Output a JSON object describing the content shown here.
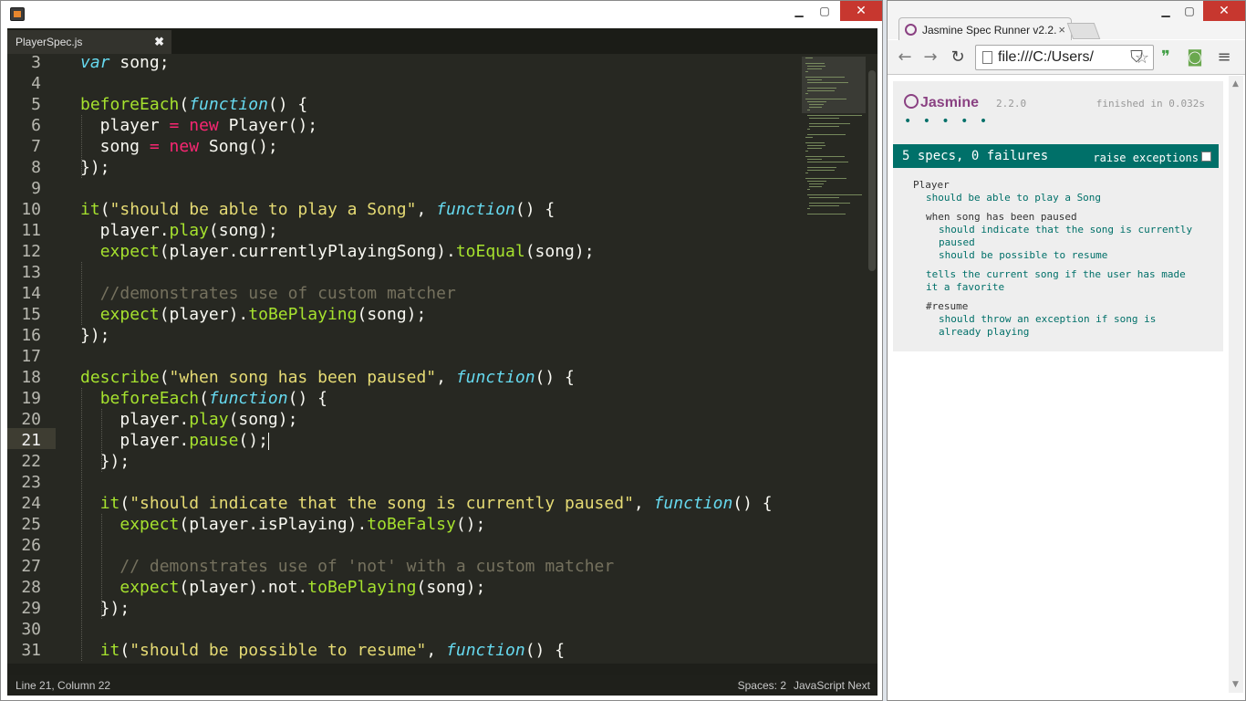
{
  "sublime": {
    "tab_label": "PlayerSpec.js",
    "tab_close": "✖",
    "line_numbers": [
      "3",
      "4",
      "5",
      "6",
      "7",
      "8",
      "9",
      "10",
      "11",
      "12",
      "13",
      "14",
      "15",
      "16",
      "17",
      "18",
      "19",
      "20",
      "21",
      "22",
      "23",
      "24",
      "25",
      "26",
      "27",
      "28",
      "29",
      "30",
      "31"
    ],
    "active_line": "21",
    "status": {
      "position": "Line 21, Column 22",
      "spaces": "Spaces: 2",
      "syntax": "JavaScript Next"
    }
  },
  "code_lines": [
    "var song;",
    "",
    "beforeEach(function() {",
    "  player = new Player();",
    "  song = new Song();",
    "});",
    "",
    "it(\"should be able to play a Song\", function() {",
    "  player.play(song);",
    "  expect(player.currentlyPlayingSong).toEqual(song);",
    "",
    "  //demonstrates use of custom matcher",
    "  expect(player).toBePlaying(song);",
    "});",
    "",
    "describe(\"when song has been paused\", function() {",
    "  beforeEach(function() {",
    "    player.play(song);",
    "    player.pause();",
    "  });",
    "",
    "  it(\"should indicate that the song is currently paused\", function() {",
    "    expect(player.isPlaying).toBeFalsy();",
    "",
    "    // demonstrates use of 'not' with a custom matcher",
    "    expect(player).not.toBePlaying(song);",
    "  });",
    "",
    "  it(\"should be possible to resume\", function() {"
  ],
  "chrome": {
    "tab_title": "Jasmine Spec Runner v2.2.",
    "tab_close": "×",
    "url": "file:///C:/Users/",
    "icons": [
      "back-arrow-icon",
      "forward-arrow-icon",
      "reload-icon",
      "star-icon",
      "pocket-icon",
      "evernote-icon",
      "android-icon",
      "menu-icon"
    ]
  },
  "jasmine": {
    "logo": "Jasmine",
    "version": "2.2.0",
    "duration": "finished in 0.032s",
    "dots": "• • • • •",
    "summary": "5 specs, 0 failures",
    "raise_label": "raise exceptions",
    "results": [
      {
        "type": "suite",
        "text": "Player"
      },
      {
        "type": "spec",
        "text": "should be able to play a Song"
      },
      {
        "type": "suite",
        "text": "when song has been paused"
      },
      {
        "type": "spec",
        "text": "should indicate that the song is currently"
      },
      {
        "type": "spec",
        "text": "paused"
      },
      {
        "type": "spec",
        "text": "should be possible to resume"
      },
      {
        "type": "spec",
        "text": "tells the current song if the user has made"
      },
      {
        "type": "spec",
        "text": "it a favorite"
      },
      {
        "type": "suite",
        "text": "#resume"
      },
      {
        "type": "spec",
        "text": "should throw an exception if song is"
      },
      {
        "type": "spec",
        "text": "already playing"
      }
    ]
  },
  "colors": {
    "editor_bg": "#272822",
    "keyword": "#f92672",
    "function": "#a6e22e",
    "string": "#e6db74",
    "comment": "#75715e",
    "jasmine_green": "#007069",
    "jasmine_purple": "#8a4182"
  }
}
